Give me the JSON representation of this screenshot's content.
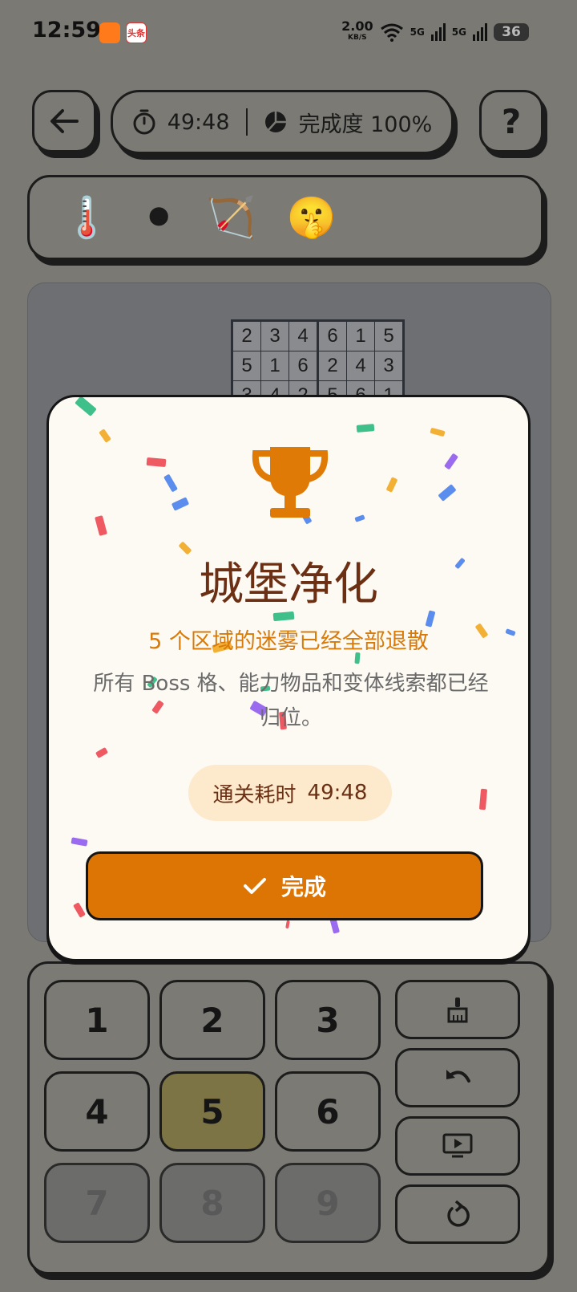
{
  "status_bar": {
    "time": "12:59",
    "app_badge": "头条",
    "net_speed": "2.00",
    "net_unit": "KB/S",
    "signal1": "5G",
    "signal2": "5G",
    "battery": "36"
  },
  "header": {
    "timer": "49:48",
    "completion": "完成度 100%",
    "help": "?"
  },
  "toolbar": {
    "items": [
      "🌡️",
      "⚫",
      "🏹",
      "🤫"
    ]
  },
  "board": {
    "rows": [
      [
        "2",
        "3",
        "4",
        "6",
        "1",
        "5"
      ],
      [
        "5",
        "1",
        "6",
        "2",
        "4",
        "3"
      ],
      [
        "3",
        "4",
        "2",
        "5",
        "6",
        "1"
      ]
    ]
  },
  "modal": {
    "title": "城堡净化",
    "subtitle": "5 个区域的迷雾已经全部退散",
    "description": "所有 Boss 格、能力物品和变体线索都已经归位。",
    "time_label": "通关耗时",
    "time_value": "49:48",
    "done_label": "完成"
  },
  "keypad": {
    "keys": [
      "1",
      "2",
      "3",
      "4",
      "5",
      "6",
      "7",
      "8",
      "9"
    ],
    "selected": "5",
    "disabled": [
      "7",
      "8",
      "9"
    ]
  },
  "colors": {
    "accent": "#dd7505",
    "title": "#6b2f13",
    "subtitle": "#d97a08"
  }
}
